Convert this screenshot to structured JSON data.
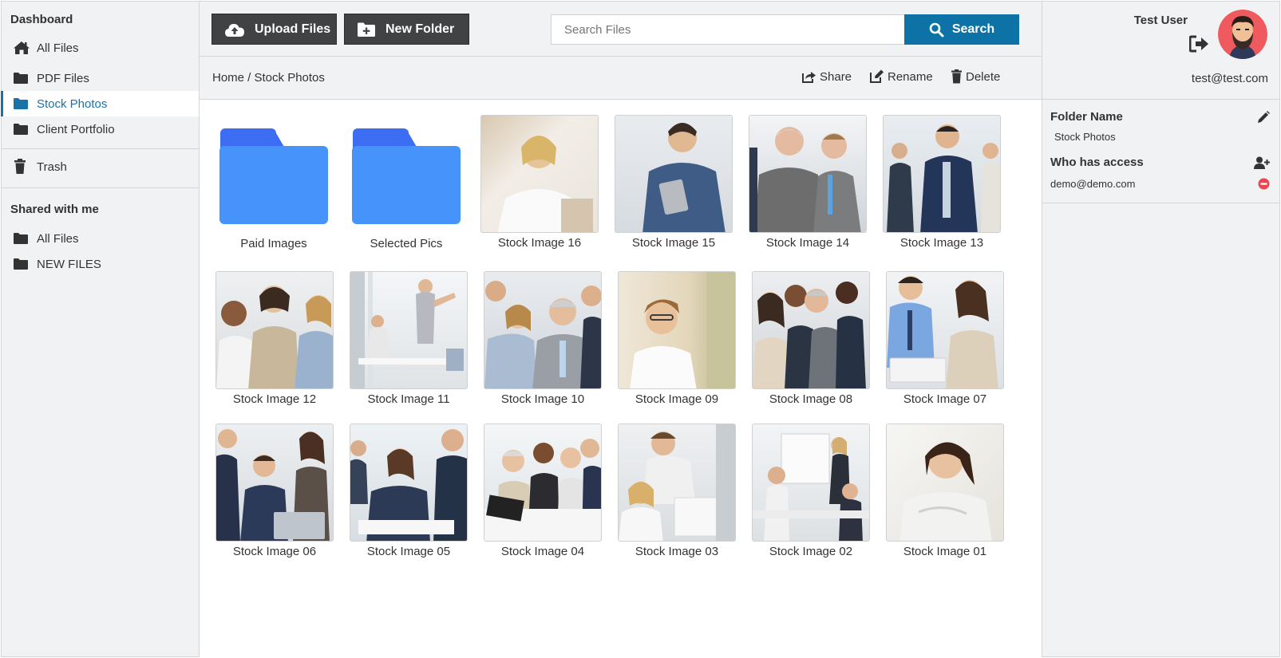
{
  "sidebar": {
    "title": "Dashboard",
    "items": [
      {
        "label": "All Files",
        "icon": "home-icon"
      },
      {
        "label": "PDF Files",
        "icon": "folder-icon"
      },
      {
        "label": "Stock Photos",
        "icon": "folder-icon",
        "active": true
      },
      {
        "label": "Client Portfolio",
        "icon": "folder-icon"
      }
    ],
    "trash_label": "Trash",
    "shared_heading": "Shared with me",
    "shared_items": [
      {
        "label": "All Files",
        "icon": "folder-icon"
      },
      {
        "label": "NEW FILES",
        "icon": "folder-icon"
      }
    ]
  },
  "toolbar": {
    "upload_label": "Upload Files",
    "new_folder_label": "New Folder",
    "search_placeholder": "Search Files",
    "search_label": "Search"
  },
  "breadcrumb": "Home / Stock Photos",
  "actions": {
    "share": "Share",
    "rename": "Rename",
    "delete": "Delete"
  },
  "folders": [
    {
      "name": "Paid Images"
    },
    {
      "name": "Selected Pics"
    }
  ],
  "images": [
    {
      "name": "Stock Image 16"
    },
    {
      "name": "Stock Image 15"
    },
    {
      "name": "Stock Image 14"
    },
    {
      "name": "Stock Image 13"
    },
    {
      "name": "Stock Image 12"
    },
    {
      "name": "Stock Image 11"
    },
    {
      "name": "Stock Image 10"
    },
    {
      "name": "Stock Image 09"
    },
    {
      "name": "Stock Image 08"
    },
    {
      "name": "Stock Image 07"
    },
    {
      "name": "Stock Image 06"
    },
    {
      "name": "Stock Image 05"
    },
    {
      "name": "Stock Image 04"
    },
    {
      "name": "Stock Image 03"
    },
    {
      "name": "Stock Image 02"
    },
    {
      "name": "Stock Image 01"
    }
  ],
  "user": {
    "name": "Test User",
    "email": "test@test.com"
  },
  "details": {
    "folder_name_label": "Folder Name",
    "folder_name_value": "Stock Photos",
    "access_label": "Who has access",
    "access_users": [
      "demo@demo.com"
    ]
  },
  "colors": {
    "accent": "#0d73a7",
    "dark_button": "#404243",
    "folder_blue": "#4693fb",
    "remove_red": "#e8474f"
  }
}
